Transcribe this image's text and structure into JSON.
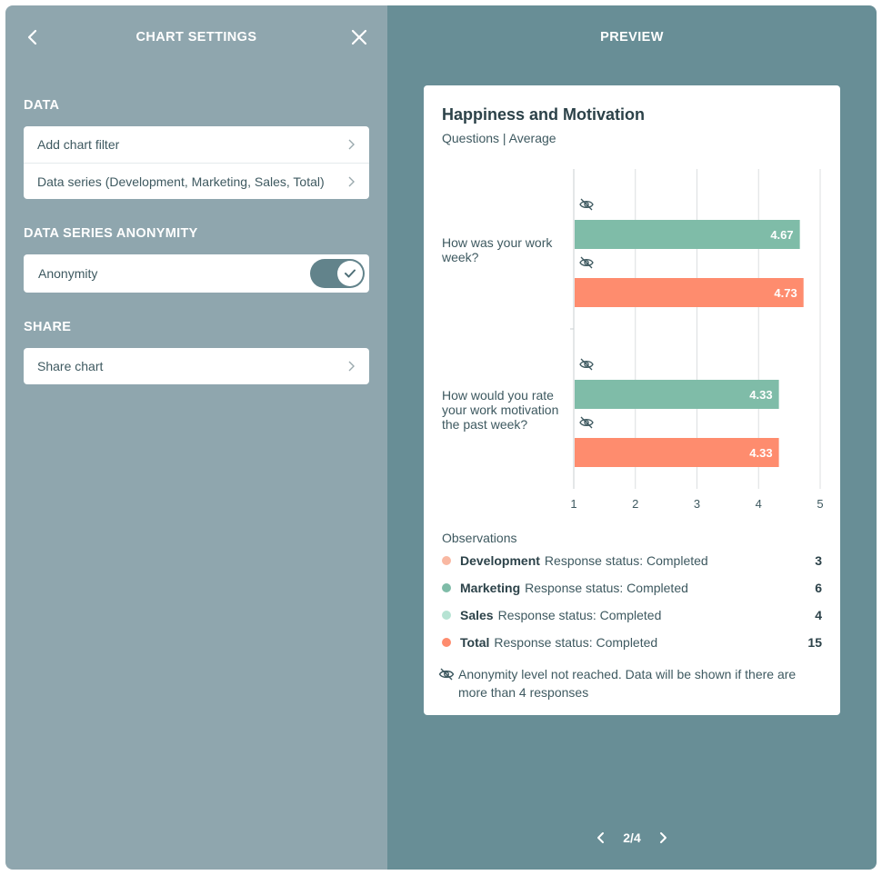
{
  "settings": {
    "title": "CHART SETTINGS",
    "back_icon": "chevron-left-icon",
    "close_icon": "close-icon"
  },
  "data_section": {
    "heading": "DATA",
    "items": [
      {
        "label": "Add chart filter"
      },
      {
        "label": "Data series (Development, Marketing, Sales, Total)"
      }
    ]
  },
  "anonymity_section": {
    "heading": "DATA SERIES ANONYMITY",
    "toggle_label": "Anonymity",
    "toggle_on": true
  },
  "share_section": {
    "heading": "SHARE",
    "items": [
      {
        "label": "Share chart"
      }
    ]
  },
  "preview": {
    "title": "PREVIEW",
    "pagination": "2/4"
  },
  "chart_data": {
    "type": "bar",
    "orientation": "horizontal",
    "title": "Happiness and Motivation",
    "subtitle": "Questions | Average",
    "categories": [
      "How was your work week?",
      "How would you rate your work motivation the past week?"
    ],
    "series": [
      {
        "name": "Development",
        "values": [
          null,
          null
        ],
        "hidden": true,
        "color": "#f9b8a2"
      },
      {
        "name": "Marketing",
        "values": [
          4.67,
          4.33
        ],
        "color": "#7fbca8"
      },
      {
        "name": "Sales",
        "values": [
          null,
          null
        ],
        "hidden": true,
        "color": "#b6e3d3"
      },
      {
        "name": "Total",
        "values": [
          4.73,
          4.33
        ],
        "color": "#fe8c6e"
      }
    ],
    "xlim": [
      1,
      5
    ],
    "xticks": [
      "1",
      "2",
      "3",
      "4",
      "5"
    ],
    "grid": true,
    "observations": {
      "title": "Observations",
      "rows": [
        {
          "name": "Development",
          "status": "Response status: Completed",
          "count": "3",
          "color": "#f9b8a2"
        },
        {
          "name": "Marketing",
          "status": "Response status: Completed",
          "count": "6",
          "color": "#7fbca8"
        },
        {
          "name": "Sales",
          "status": "Response status: Completed",
          "count": "4",
          "color": "#b6e3d3"
        },
        {
          "name": "Total",
          "status": "Response status: Completed",
          "count": "15",
          "color": "#fe8c6e"
        }
      ]
    },
    "anonymity_note": "Anonymity level not reached. Data will be shown if there are more than 4 responses"
  }
}
